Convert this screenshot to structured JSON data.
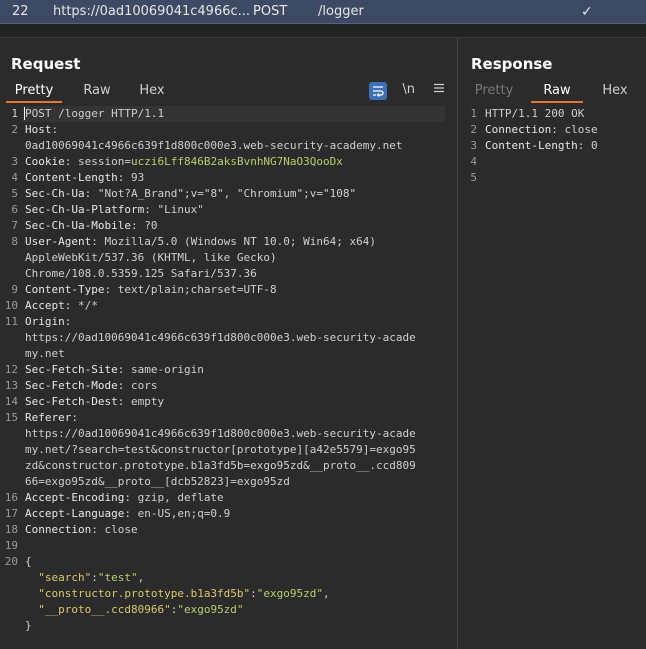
{
  "history_row": {
    "number": "22",
    "url": "https://0ad10069041c4966c...",
    "method": "POST",
    "path": "/logger",
    "check": "✓"
  },
  "request": {
    "title": "Request",
    "tabs": [
      "Pretty",
      "Raw",
      "Hex"
    ],
    "active_tab": "Pretty",
    "tools": {
      "wrap_icon": "wrap-lines-icon",
      "newline_label": "\\n",
      "menu_icon": "hamburger-menu-icon"
    },
    "lines": [
      {
        "n": "1",
        "parts": [
          {
            "t": "POST /logger HTTP/1.1",
            "c": "val"
          }
        ]
      },
      {
        "n": "2",
        "parts": [
          {
            "t": "Host",
            "c": "key"
          },
          {
            "t": ":",
            "c": "val"
          }
        ]
      },
      {
        "n": "",
        "parts": [
          {
            "t": "0ad10069041c4966c639f1d800c000e3.web-security-academy.net",
            "c": "val"
          }
        ]
      },
      {
        "n": "3",
        "parts": [
          {
            "t": "Cookie",
            "c": "key"
          },
          {
            "t": ": session=",
            "c": "val"
          },
          {
            "t": "uczi6Lff846B2aksBvnhNG7NaO3QooDx",
            "c": "cookie-val"
          }
        ]
      },
      {
        "n": "4",
        "parts": [
          {
            "t": "Content-Length",
            "c": "key"
          },
          {
            "t": ": 93",
            "c": "val"
          }
        ]
      },
      {
        "n": "5",
        "parts": [
          {
            "t": "Sec-Ch-Ua",
            "c": "key"
          },
          {
            "t": ": \"Not?A_Brand\";v=\"8\", \"Chromium\";v=\"108\"",
            "c": "val"
          }
        ]
      },
      {
        "n": "6",
        "parts": [
          {
            "t": "Sec-Ch-Ua-Platform",
            "c": "key"
          },
          {
            "t": ": \"Linux\"",
            "c": "val"
          }
        ]
      },
      {
        "n": "7",
        "parts": [
          {
            "t": "Sec-Ch-Ua-Mobile",
            "c": "key"
          },
          {
            "t": ": ?0",
            "c": "val"
          }
        ]
      },
      {
        "n": "8",
        "parts": [
          {
            "t": "User-Agent",
            "c": "key"
          },
          {
            "t": ": Mozilla/5.0 (Windows NT 10.0; Win64; x64)",
            "c": "val"
          }
        ]
      },
      {
        "n": "",
        "parts": [
          {
            "t": "AppleWebKit/537.36 (KHTML, like Gecko)",
            "c": "val"
          }
        ]
      },
      {
        "n": "",
        "parts": [
          {
            "t": "Chrome/108.0.5359.125 Safari/537.36",
            "c": "val"
          }
        ]
      },
      {
        "n": "9",
        "parts": [
          {
            "t": "Content-Type",
            "c": "key"
          },
          {
            "t": ": text/plain;charset=UTF-8",
            "c": "val"
          }
        ]
      },
      {
        "n": "10",
        "parts": [
          {
            "t": "Accept",
            "c": "key"
          },
          {
            "t": ": */*",
            "c": "val"
          }
        ]
      },
      {
        "n": "11",
        "parts": [
          {
            "t": "Origin",
            "c": "key"
          },
          {
            "t": ":",
            "c": "val"
          }
        ]
      },
      {
        "n": "",
        "parts": [
          {
            "t": "https://0ad10069041c4966c639f1d800c000e3.web-security-acade",
            "c": "val"
          }
        ]
      },
      {
        "n": "",
        "parts": [
          {
            "t": "my.net",
            "c": "val"
          }
        ]
      },
      {
        "n": "12",
        "parts": [
          {
            "t": "Sec-Fetch-Site",
            "c": "key"
          },
          {
            "t": ": same-origin",
            "c": "val"
          }
        ]
      },
      {
        "n": "13",
        "parts": [
          {
            "t": "Sec-Fetch-Mode",
            "c": "key"
          },
          {
            "t": ": cors",
            "c": "val"
          }
        ]
      },
      {
        "n": "14",
        "parts": [
          {
            "t": "Sec-Fetch-Dest",
            "c": "key"
          },
          {
            "t": ": empty",
            "c": "val"
          }
        ]
      },
      {
        "n": "15",
        "parts": [
          {
            "t": "Referer",
            "c": "key"
          },
          {
            "t": ":",
            "c": "val"
          }
        ]
      },
      {
        "n": "",
        "parts": [
          {
            "t": "https://0ad10069041c4966c639f1d800c000e3.web-security-acade",
            "c": "val"
          }
        ]
      },
      {
        "n": "",
        "parts": [
          {
            "t": "my.net/?search=test&constructor[prototype][a42e5579]=exgo95",
            "c": "val"
          }
        ]
      },
      {
        "n": "",
        "parts": [
          {
            "t": "zd&constructor.prototype.b1a3fd5b=exgo95zd&__proto__.ccd809",
            "c": "val"
          }
        ]
      },
      {
        "n": "",
        "parts": [
          {
            "t": "66=exgo95zd&__proto__[dcb52823]=exgo95zd",
            "c": "val"
          }
        ]
      },
      {
        "n": "16",
        "parts": [
          {
            "t": "Accept-Encoding",
            "c": "key"
          },
          {
            "t": ": gzip, deflate",
            "c": "val"
          }
        ]
      },
      {
        "n": "17",
        "parts": [
          {
            "t": "Accept-Language",
            "c": "key"
          },
          {
            "t": ": en-US,en;q=0.9",
            "c": "val"
          }
        ]
      },
      {
        "n": "18",
        "parts": [
          {
            "t": "Connection",
            "c": "key"
          },
          {
            "t": ": close",
            "c": "val"
          }
        ]
      },
      {
        "n": "19",
        "parts": []
      },
      {
        "n": "20",
        "parts": [
          {
            "t": "{",
            "c": "val"
          }
        ]
      },
      {
        "n": "",
        "parts": [
          {
            "t": "  ",
            "c": "val"
          },
          {
            "t": "\"search\"",
            "c": "json-key"
          },
          {
            "t": ":",
            "c": "val"
          },
          {
            "t": "\"test\"",
            "c": "json-str"
          },
          {
            "t": ",",
            "c": "val"
          }
        ]
      },
      {
        "n": "",
        "parts": [
          {
            "t": "  ",
            "c": "val"
          },
          {
            "t": "\"constructor.prototype.b1a3fd5b\"",
            "c": "json-key"
          },
          {
            "t": ":",
            "c": "val"
          },
          {
            "t": "\"exgo95zd\"",
            "c": "json-str"
          },
          {
            "t": ",",
            "c": "val"
          }
        ]
      },
      {
        "n": "",
        "parts": [
          {
            "t": "  ",
            "c": "val"
          },
          {
            "t": "\"__proto__.ccd80966\"",
            "c": "json-key"
          },
          {
            "t": ":",
            "c": "val"
          },
          {
            "t": "\"exgo95zd\"",
            "c": "json-str"
          }
        ]
      },
      {
        "n": "",
        "parts": [
          {
            "t": "}",
            "c": "val"
          }
        ]
      }
    ]
  },
  "response": {
    "title": "Response",
    "tabs": [
      "Pretty",
      "Raw",
      "Hex"
    ],
    "active_tab": "Raw",
    "lines": [
      {
        "n": "1",
        "parts": [
          {
            "t": "HTTP/1.1 200 OK",
            "c": "val"
          }
        ]
      },
      {
        "n": "2",
        "parts": [
          {
            "t": "Connection",
            "c": "key"
          },
          {
            "t": ": close",
            "c": "val"
          }
        ]
      },
      {
        "n": "3",
        "parts": [
          {
            "t": "Content-Length",
            "c": "key"
          },
          {
            "t": ": 0",
            "c": "val"
          }
        ]
      },
      {
        "n": "4",
        "parts": []
      },
      {
        "n": "5",
        "parts": []
      }
    ]
  },
  "colors": {
    "accent": "#e8742f",
    "selected_row": "#3c4a63",
    "background": "#2b2b2b",
    "cookie_value": "#b5cf6b",
    "json_key": "#d9c96a",
    "wrap_button": "#3b6fb6"
  }
}
